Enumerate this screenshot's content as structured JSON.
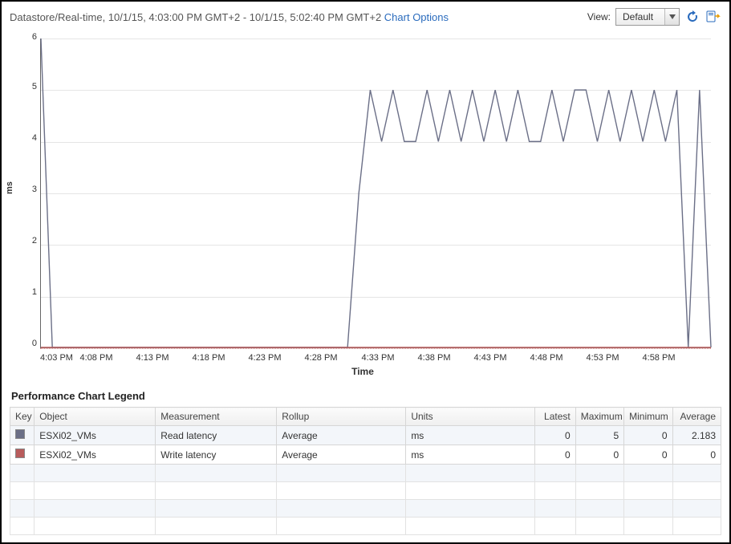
{
  "header": {
    "title": "Datastore/Real-time, 10/1/15, 4:03:00 PM GMT+2 - 10/1/15, 5:02:40 PM GMT+2",
    "chart_options": "Chart Options",
    "view_label": "View:",
    "view_value": "Default"
  },
  "chart_data": {
    "type": "line",
    "title": "",
    "xlabel": "Time",
    "ylabel": "ms",
    "ylim": [
      0,
      6
    ],
    "x_categories": [
      "4:03 PM",
      "4:08 PM",
      "4:13 PM",
      "4:18 PM",
      "4:23 PM",
      "4:28 PM",
      "4:33 PM",
      "4:38 PM",
      "4:43 PM",
      "4:48 PM",
      "4:53 PM",
      "4:58 PM"
    ],
    "y_ticks": [
      0,
      1,
      2,
      3,
      4,
      5,
      6
    ],
    "x_minutes": [
      3,
      4,
      5,
      6,
      7,
      8,
      9,
      10,
      11,
      12,
      13,
      14,
      15,
      16,
      17,
      18,
      19,
      20,
      21,
      22,
      23,
      24,
      25,
      26,
      27,
      28,
      29,
      30,
      31,
      32,
      33,
      34,
      35,
      36,
      37,
      38,
      39,
      40,
      41,
      42,
      43,
      44,
      45,
      46,
      47,
      48,
      49,
      50,
      51,
      52,
      53,
      54,
      55,
      56,
      57,
      58,
      59,
      60,
      61,
      62
    ],
    "series": [
      {
        "name": "Read latency",
        "color": "#6b6f87",
        "values": [
          6,
          0,
          0,
          0,
          0,
          0,
          0,
          0,
          0,
          0,
          0,
          0,
          0,
          0,
          0,
          0,
          0,
          0,
          0,
          0,
          0,
          0,
          0,
          0,
          0,
          0,
          0,
          0,
          3,
          5,
          4,
          5,
          4,
          4,
          5,
          4,
          5,
          4,
          5,
          4,
          5,
          4,
          5,
          4,
          4,
          5,
          4,
          5,
          5,
          4,
          5,
          4,
          5,
          4,
          5,
          4,
          5,
          0,
          5,
          0
        ]
      },
      {
        "name": "Write latency",
        "color": "#b85c5c",
        "values": [
          0,
          0,
          0,
          0,
          0,
          0,
          0,
          0,
          0,
          0,
          0,
          0,
          0,
          0,
          0,
          0,
          0,
          0,
          0,
          0,
          0,
          0,
          0,
          0,
          0,
          0,
          0,
          0,
          0,
          0,
          0,
          0,
          0,
          0,
          0,
          0,
          0,
          0,
          0,
          0,
          0,
          0,
          0,
          0,
          0,
          0,
          0,
          0,
          0,
          0,
          0,
          0,
          0,
          0,
          0,
          0,
          0,
          0,
          0,
          0
        ]
      }
    ]
  },
  "legend": {
    "title": "Performance Chart Legend",
    "columns": {
      "key": "Key",
      "object": "Object",
      "measurement": "Measurement",
      "rollup": "Rollup",
      "units": "Units",
      "latest": "Latest",
      "maximum": "Maximum",
      "minimum": "Minimum",
      "average": "Average"
    },
    "rows": [
      {
        "color": "#6b6f87",
        "object": "ESXi02_VMs",
        "measurement": "Read latency",
        "rollup": "Average",
        "units": "ms",
        "latest": "0",
        "maximum": "5",
        "minimum": "0",
        "average": "2.183"
      },
      {
        "color": "#b85c5c",
        "object": "ESXi02_VMs",
        "measurement": "Write latency",
        "rollup": "Average",
        "units": "ms",
        "latest": "0",
        "maximum": "0",
        "minimum": "0",
        "average": "0"
      }
    ]
  }
}
